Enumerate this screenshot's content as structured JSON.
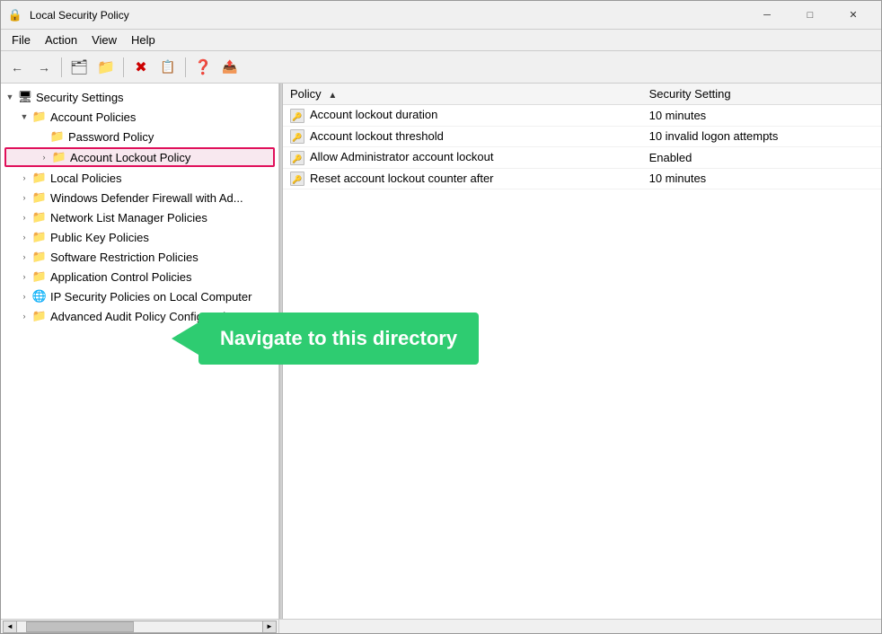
{
  "window": {
    "title": "Local Security Policy",
    "icon": "🔒"
  },
  "titlebar": {
    "minimize": "─",
    "maximize": "□",
    "close": "✕"
  },
  "menu": {
    "items": [
      "File",
      "Action",
      "View",
      "Help"
    ]
  },
  "toolbar": {
    "buttons": [
      {
        "name": "back",
        "icon": "←"
      },
      {
        "name": "forward",
        "icon": "→"
      },
      {
        "name": "up",
        "icon": "📁"
      },
      {
        "name": "show-hide-tree",
        "icon": "🗂"
      },
      {
        "name": "delete",
        "icon": "✖"
      },
      {
        "name": "properties",
        "icon": "📋"
      },
      {
        "name": "help",
        "icon": "❓"
      },
      {
        "name": "export",
        "icon": "📤"
      }
    ]
  },
  "tree": {
    "root": {
      "label": "Security Settings",
      "icon": "🖥"
    },
    "items": [
      {
        "label": "Account Policies",
        "icon": "📁",
        "level": 1,
        "expanded": true,
        "toggle": "▼",
        "children": [
          {
            "label": "Password Policy",
            "icon": "📁",
            "level": 2,
            "toggle": ""
          },
          {
            "label": "Account Lockout Policy",
            "icon": "📁",
            "level": 2,
            "toggle": "›",
            "highlighted": true,
            "selected": false
          }
        ]
      },
      {
        "label": "Local Policies",
        "icon": "📁",
        "level": 1,
        "toggle": "›"
      },
      {
        "label": "Windows Defender Firewall with Ad...",
        "icon": "📁",
        "level": 1,
        "toggle": "›"
      },
      {
        "label": "Network List Manager Policies",
        "icon": "📁",
        "level": 1,
        "toggle": "›"
      },
      {
        "label": "Public Key Policies",
        "icon": "📁",
        "level": 1,
        "toggle": "›"
      },
      {
        "label": "Software Restriction Policies",
        "icon": "📁",
        "level": 1,
        "toggle": "›"
      },
      {
        "label": "Application Control Policies",
        "icon": "📁",
        "level": 1,
        "toggle": "›"
      },
      {
        "label": "IP Security Policies on Local Computer",
        "icon": "🌐",
        "level": 1,
        "toggle": "›"
      },
      {
        "label": "Advanced Audit Policy Configuration",
        "icon": "📁",
        "level": 1,
        "toggle": "›"
      }
    ]
  },
  "right_pane": {
    "columns": [
      {
        "label": "Policy",
        "width": "60%",
        "sort_arrow": "▲"
      },
      {
        "label": "Security Setting",
        "width": "40%"
      }
    ],
    "rows": [
      {
        "policy": "Account lockout duration",
        "setting": "10 minutes"
      },
      {
        "policy": "Account lockout threshold",
        "setting": "10 invalid logon attempts"
      },
      {
        "policy": "Allow Administrator account lockout",
        "setting": "Enabled"
      },
      {
        "policy": "Reset account lockout counter after",
        "setting": "10 minutes"
      }
    ]
  },
  "callout": {
    "text": "Navigate to this directory"
  },
  "status_bar": {}
}
